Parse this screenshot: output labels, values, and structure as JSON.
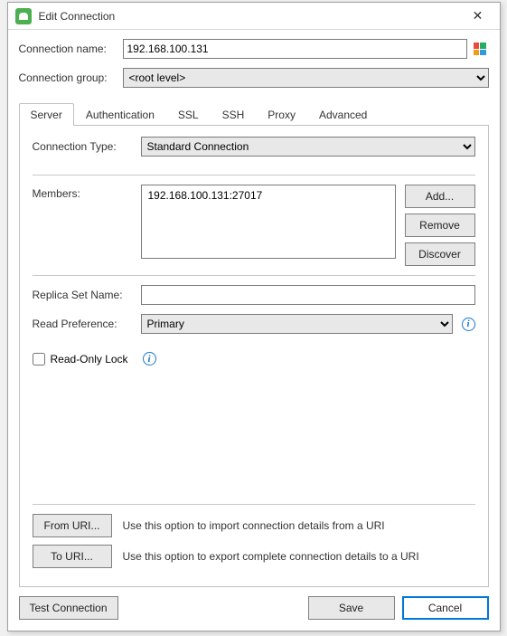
{
  "window": {
    "title": "Edit Connection"
  },
  "labels": {
    "connection_name": "Connection name:",
    "connection_group": "Connection group:"
  },
  "fields": {
    "connection_name_value": "192.168.100.131",
    "connection_group_value": "<root level>"
  },
  "tabs": {
    "server": "Server",
    "authentication": "Authentication",
    "ssl": "SSL",
    "ssh": "SSH",
    "proxy": "Proxy",
    "advanced": "Advanced"
  },
  "server": {
    "labels": {
      "connection_type": "Connection Type:",
      "members": "Members:",
      "replica_set_name": "Replica Set Name:",
      "read_preference": "Read Preference:",
      "read_only_lock": "Read-Only Lock"
    },
    "connection_type_value": "Standard Connection",
    "members": [
      "192.168.100.131:27017"
    ],
    "replica_set_name_value": "",
    "read_preference_value": "Primary",
    "buttons": {
      "add": "Add...",
      "remove": "Remove",
      "discover": "Discover"
    },
    "read_only_lock_checked": false
  },
  "uri": {
    "from_uri_btn": "From URI...",
    "from_uri_text": "Use this option to import connection details from a URI",
    "to_uri_btn": "To URI...",
    "to_uri_text": "Use this option to export complete connection details to a URI"
  },
  "footer": {
    "test_connection": "Test Connection",
    "save": "Save",
    "cancel": "Cancel"
  }
}
